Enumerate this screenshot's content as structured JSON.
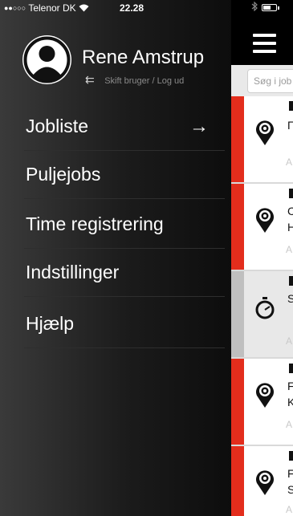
{
  "status_bar": {
    "signal": "●●○○○",
    "carrier": "Telenor DK",
    "wifi": "⫗",
    "time": "22.28",
    "bluetooth": "✱"
  },
  "user": {
    "name": "Rene Amstrup",
    "switch_icon": "⇇",
    "switch_label": "Skift bruger / Log ud"
  },
  "menu": {
    "items": [
      {
        "label": "Jobliste"
      },
      {
        "label": "Puljejobs"
      },
      {
        "label": "Time registrering"
      },
      {
        "label": "Indstillinger"
      },
      {
        "label": "Hjælp"
      }
    ],
    "active_arrow": "→"
  },
  "app": {
    "search_placeholder": "Søg i job",
    "jobs": [
      {
        "lines": [
          "Γ",
          ""
        ],
        "addr": "A",
        "icon": "gear-pin-icon"
      },
      {
        "lines": [
          "C",
          "H"
        ],
        "addr": "A",
        "icon": "gear-pin-icon"
      },
      {
        "lines": [
          "S",
          ""
        ],
        "addr": "A",
        "icon": "stopwatch-icon"
      },
      {
        "lines": [
          "F",
          "K"
        ],
        "addr": "A",
        "icon": "gear-pin-icon"
      },
      {
        "lines": [
          "F",
          "S"
        ],
        "addr": "A",
        "icon": "gear-pin-icon"
      }
    ]
  },
  "colors": {
    "accent": "#e32d1c",
    "menu_bg": "#1b1b1b"
  }
}
